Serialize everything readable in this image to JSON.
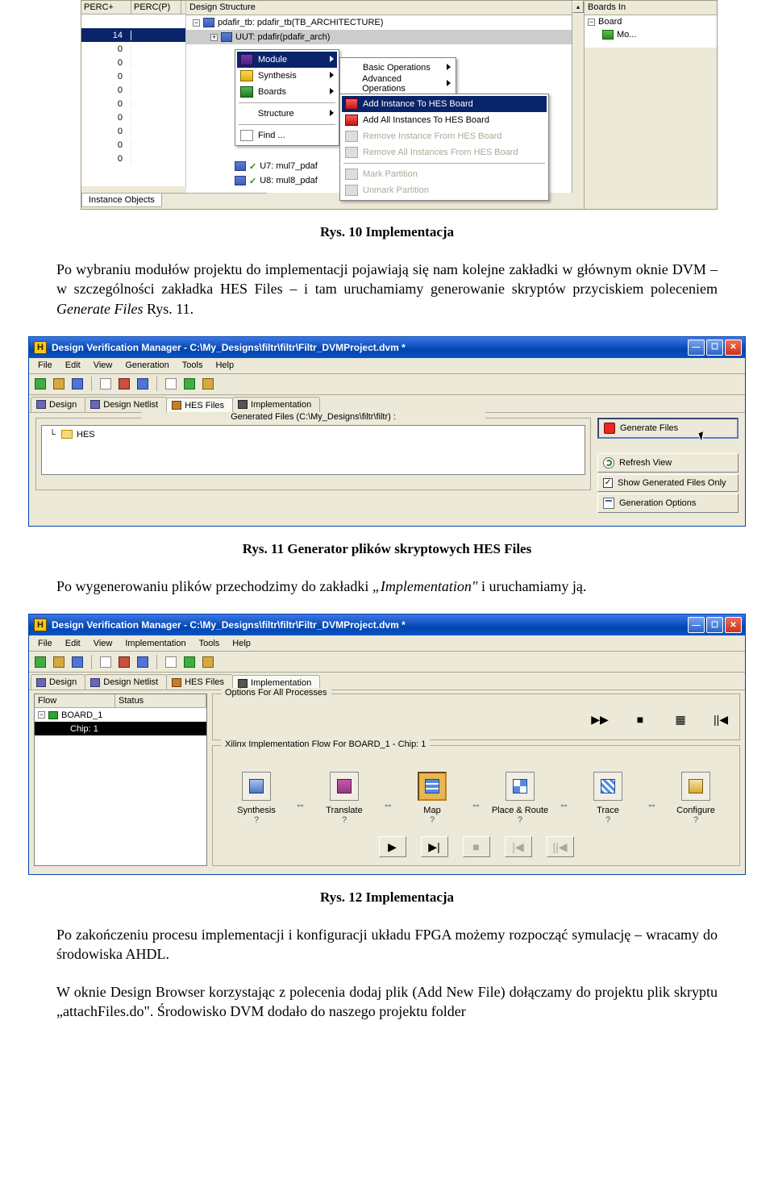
{
  "fig1": {
    "tableHeaders": {
      "c1": "PERC+",
      "c2": "PERC(P)"
    },
    "designStructureHeader": "Design Structure",
    "tableRows": [
      {
        "c1": ""
      },
      {
        "c1": "14",
        "sel": true
      },
      {
        "c1": "0"
      },
      {
        "c1": "0"
      },
      {
        "c1": "0"
      },
      {
        "c1": "0"
      },
      {
        "c1": "0"
      },
      {
        "c1": "0"
      },
      {
        "c1": "0"
      },
      {
        "c1": "0"
      },
      {
        "c1": "0"
      }
    ],
    "bottomTab": "Instance Objects",
    "treeRows": [
      {
        "text": "pdafir_tb: pdafir_tb(TB_ARCHITECTURE)",
        "box": "−",
        "icon": "ti-blue",
        "indent": 0
      },
      {
        "text": "UUT: pdafir(pdafir_arch)",
        "box": "+",
        "icon": "ti-blue",
        "indent": 1,
        "sel": true
      }
    ],
    "treeExtraRows": [
      {
        "text": "U7: mul7_pdaf",
        "icon": "ti-blue"
      },
      {
        "text": "U8: mul8_pdaf",
        "icon": "ti-blue"
      }
    ],
    "rightHeader": "Boards In",
    "rightRows": [
      "Board",
      "Mo..."
    ],
    "ctxMenu1": [
      {
        "label": "Module",
        "icon": "ci-module",
        "arrow": true,
        "sel": true
      },
      {
        "label": "Synthesis",
        "icon": "ci-synth",
        "arrow": true
      },
      {
        "label": "Boards",
        "icon": "ci-boards",
        "arrow": true
      },
      {
        "sep": true
      },
      {
        "label": "Structure",
        "arrow": true
      },
      {
        "sep": true
      },
      {
        "label": "Find ...",
        "icon": "ci-find"
      }
    ],
    "ctxMenu2": [
      {
        "label": "Basic Operations",
        "arrow": true
      },
      {
        "label": "Advanced Operations",
        "arrow": true
      }
    ],
    "ctxMenu3": [
      {
        "label": "Add Instance To HES Board",
        "icon": "ci-red",
        "sel": true
      },
      {
        "label": "Add All Instances To HES Board",
        "icon": "ci-red"
      },
      {
        "label": "Remove Instance From HES Board",
        "icon": "ci-grey",
        "disabled": true
      },
      {
        "label": "Remove All Instances From HES Board",
        "icon": "ci-grey",
        "disabled": true
      },
      {
        "sep": true
      },
      {
        "label": "Mark Partition",
        "icon": "ci-grey",
        "disabled": true
      },
      {
        "label": "Unmark Partition",
        "icon": "ci-grey",
        "disabled": true
      }
    ]
  },
  "caption1": "Rys. 10 Implementacja",
  "para1_a": "Po wybraniu modułów projektu do implementacji pojawiają się nam kolejne zakładki w głównym oknie DVM – w szczególności zakładka HES Files – i tam uruchamiamy generowanie skryptów przyciskiem poleceniem ",
  "para1_it": "Generate Files",
  "para1_b": " Rys. 11.",
  "appCommon": {
    "title": "Design Verification Manager - C:\\My_Designs\\filtr\\filtr\\Filtr_DVMProject.dvm *",
    "winMin": "—",
    "winMax": "☐",
    "winClose": "✕"
  },
  "fig2": {
    "menubar": [
      "File",
      "Edit",
      "View",
      "Generation",
      "Tools",
      "Help"
    ],
    "tabs": [
      {
        "label": "Design",
        "icon": "tab-i"
      },
      {
        "label": "Design Netlist",
        "icon": "tab-i"
      },
      {
        "label": "HES Files",
        "icon": "tab-i2",
        "active": true
      },
      {
        "label": "Implementation",
        "icon": "tab-i3"
      }
    ],
    "groupLabel": "Generated Files (C:\\My_Designs\\filtr\\filtr) :",
    "treeRoot": "HES",
    "buttons": [
      {
        "label": "Generate Files",
        "icon": "gi-red",
        "highlight": true
      },
      {
        "label": "Refresh View",
        "icon": "gi-refresh"
      },
      {
        "label": "Show Generated Files Only",
        "check": true
      },
      {
        "label": "Generation Options",
        "icon": "gi-opts"
      }
    ]
  },
  "caption2": "Rys. 11 Generator plików skryptowych HES Files",
  "para2_a": "Po wygenerowaniu plików przechodzimy do zakładki ",
  "para2_it": "„Implementation\"",
  "para2_b": " i uruchamiamy ją.",
  "fig3": {
    "menubar": [
      "File",
      "Edit",
      "View",
      "Implementation",
      "Tools",
      "Help"
    ],
    "tabs": [
      {
        "label": "Design",
        "icon": "tab-i"
      },
      {
        "label": "Design Netlist",
        "icon": "tab-i"
      },
      {
        "label": "HES Files",
        "icon": "tab-i2"
      },
      {
        "label": "Implementation",
        "icon": "tab-i3",
        "active": true
      }
    ],
    "leftHeaders": {
      "flow": "Flow",
      "status": "Status"
    },
    "leftRows": [
      {
        "label": "BOARD_1",
        "icon": "board-i",
        "box": "−"
      },
      {
        "label": "Chip: 1",
        "icon": "chip-i",
        "sel": true,
        "indent": 1
      }
    ],
    "optsLabel": "Options For All Processes",
    "optsBtns": [
      "▶▶",
      "■",
      "▦",
      "||◀"
    ],
    "flowLabel": "Xilinx Implementation Flow For BOARD_1 - Chip: 1",
    "flowSteps": [
      {
        "name": "Synthesis",
        "fi": "fi-s"
      },
      {
        "name": "Translate",
        "fi": "fi-t"
      },
      {
        "name": "Map",
        "fi": "fi-m",
        "sel": true
      },
      {
        "name": "Place & Route",
        "fi": "fi-p"
      },
      {
        "name": "Trace",
        "fi": "fi-tr"
      },
      {
        "name": "Configure",
        "fi": "fi-c"
      }
    ],
    "flowQ": "?",
    "ctrlBtns": [
      "▶",
      "▶|",
      "■",
      "|◀",
      "||◀"
    ]
  },
  "caption3": "Rys. 12 Implementacja",
  "para3": "Po zakończeniu procesu implementacji i konfiguracji układu FPGA możemy rozpocząć symulację – wracamy do środowiska AHDL.",
  "para4": "W oknie Design Browser korzystając z polecenia dodaj plik (Add New File) dołączamy do projektu plik skryptu „attachFiles.do\".  Środowisko DVM dodało do naszego projektu folder"
}
